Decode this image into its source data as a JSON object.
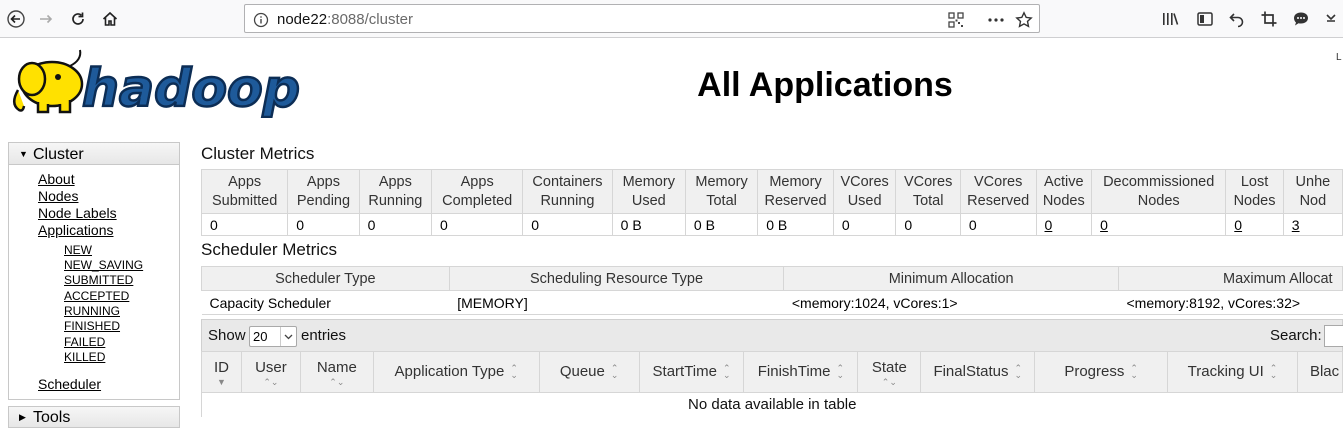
{
  "browser": {
    "url_host": "node22",
    "url_rest": ":8088/cluster",
    "edge_letter": "L"
  },
  "header": {
    "logo_text": "hadoop",
    "title": "All Applications"
  },
  "sidebar": {
    "cluster_label": "Cluster",
    "cluster_links": [
      "About",
      "Nodes",
      "Node Labels",
      "Applications"
    ],
    "app_states": [
      "NEW",
      "NEW_SAVING",
      "SUBMITTED",
      "ACCEPTED",
      "RUNNING",
      "FINISHED",
      "FAILED",
      "KILLED"
    ],
    "scheduler_link": "Scheduler",
    "tools_label": "Tools"
  },
  "cluster_metrics": {
    "title": "Cluster Metrics",
    "headers": [
      "Apps Submitted",
      "Apps Pending",
      "Apps Running",
      "Apps Completed",
      "Containers Running",
      "Memory Used",
      "Memory Total",
      "Memory Reserved",
      "VCores Used",
      "VCores Total",
      "VCores Reserved",
      "Active Nodes",
      "Decommissioned Nodes",
      "Lost Nodes",
      "Unhe Nod"
    ],
    "values": [
      "0",
      "0",
      "0",
      "0",
      "0",
      "0 B",
      "0 B",
      "0 B",
      "0",
      "0",
      "0",
      "0",
      "0",
      "0",
      "3"
    ]
  },
  "scheduler_metrics": {
    "title": "Scheduler Metrics",
    "headers": [
      "Scheduler Type",
      "Scheduling Resource Type",
      "Minimum Allocation",
      "Maximum Allocat"
    ],
    "values": [
      "Capacity Scheduler",
      "[MEMORY]",
      "<memory:1024, vCores:1>",
      "<memory:8192, vCores:32>"
    ]
  },
  "apps_table": {
    "show_label": "Show",
    "entries_value": "20",
    "entries_label": "entries",
    "search_label": "Search:",
    "search_value": "",
    "headers": [
      "ID",
      "User",
      "Name",
      "Application Type",
      "Queue",
      "StartTime",
      "FinishTime",
      "State",
      "FinalStatus",
      "Progress",
      "Tracking UI",
      "Blac"
    ],
    "empty_message": "No data available in table"
  }
}
